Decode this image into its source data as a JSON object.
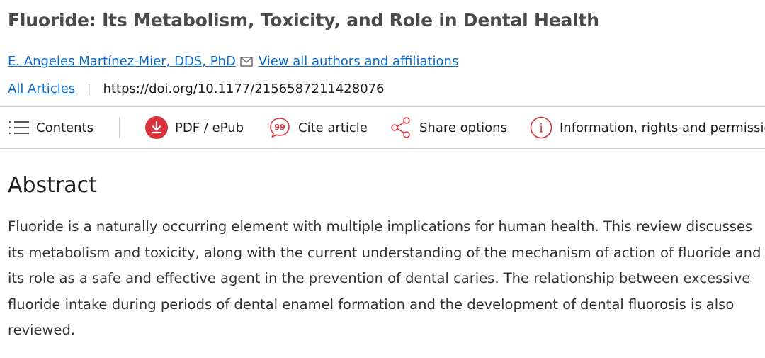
{
  "article": {
    "title": "Fluoride: Its Metabolism, Toxicity, and Role in Dental Health",
    "author": "E. Angeles Martínez-Mier, DDS, PhD",
    "author_contact_icon": "mail-icon",
    "all_authors_link": "View all authors and affiliations",
    "all_articles_link": "All Articles",
    "separator": "|",
    "doi": "https://doi.org/10.1177/2156587211428076"
  },
  "toolbar": {
    "contents": {
      "label": "Contents",
      "icon": "list-icon"
    },
    "pdf": {
      "label": "PDF / ePub",
      "icon": "download-icon"
    },
    "cite": {
      "label": "Cite article",
      "icon": "quote-icon"
    },
    "share": {
      "label": "Share options",
      "icon": "share-icon"
    },
    "info": {
      "label": "Information, rights and permissions",
      "icon": "info-icon"
    }
  },
  "abstract": {
    "heading": "Abstract",
    "text": "Fluoride is a naturally occurring element with multiple implications for human health. This review discusses its metabolism and toxicity, along with the current understanding of the mechanism of action of fluoride and its role as a safe and effective agent in the prevention of dental caries. The relationship between excessive fluoride intake during periods of dental enamel formation and the development of dental fluorosis is also reviewed."
  },
  "colors": {
    "link": "#0b6bcb",
    "accent_red": "#d8333b",
    "title_gray": "#4a4a4a"
  }
}
